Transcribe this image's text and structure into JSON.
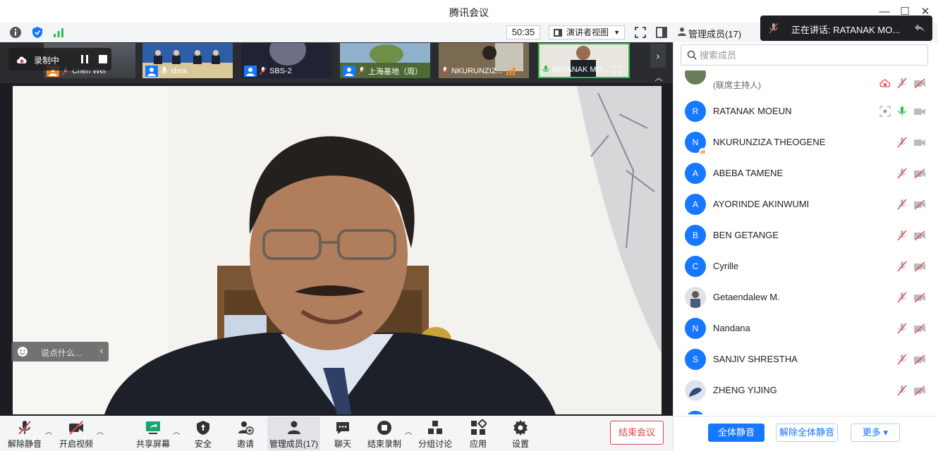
{
  "window": {
    "title": "腾讯会议",
    "minimize": "—",
    "maximize": "☐",
    "close": "✕"
  },
  "toolbar": {
    "timer": "50:35",
    "view_mode": "演讲者视图"
  },
  "recording": {
    "status": "录制中"
  },
  "thumbnails": [
    {
      "name": "Chen Wei"
    },
    {
      "name": "sbns"
    },
    {
      "name": "SBS-2"
    },
    {
      "name": "上海基地（周）"
    },
    {
      "name": "NKURUNZIZ..."
    },
    {
      "name": "RATANAK MO..."
    }
  ],
  "chat": {
    "placeholder": "说点什么..."
  },
  "bottom_bar": {
    "unmute": "解除静音",
    "start_video": "开启视频",
    "share_screen": "共享屏幕",
    "security": "安全",
    "invite": "邀请",
    "members": "管理成员(17)",
    "chat": "聊天",
    "stop_record": "结束录制",
    "breakout": "分组讨论",
    "apps": "应用",
    "settings": "设置",
    "end_meeting": "结束会议"
  },
  "panel": {
    "title": "管理成员(17)",
    "search_placeholder": "搜索成员",
    "cohost_note": "(联席主持人)",
    "members": [
      {
        "initial": "R",
        "name": "RATANAK MOEUN",
        "color": "#1677ff"
      },
      {
        "initial": "N",
        "name": "NKURUNZIZA THEOGENE",
        "color": "#1677ff"
      },
      {
        "initial": "A",
        "name": "ABEBA TAMENE",
        "color": "#1677ff"
      },
      {
        "initial": "A",
        "name": "AYORINDE AKINWUMI",
        "color": "#1677ff"
      },
      {
        "initial": "B",
        "name": "BEN GETANGE",
        "color": "#1677ff"
      },
      {
        "initial": "C",
        "name": "Cyrille",
        "color": "#1677ff"
      },
      {
        "initial": "",
        "name": "Getaendalew M.",
        "color": "#8a8f99"
      },
      {
        "initial": "N",
        "name": "Nandana",
        "color": "#1677ff"
      },
      {
        "initial": "S",
        "name": "SANJIV SHRESTHA",
        "color": "#1677ff"
      },
      {
        "initial": "",
        "name": "ZHENG YIJING",
        "color": "#2d4a7a"
      }
    ],
    "mute_all": "全体静音",
    "unmute_all": "解除全体静音",
    "more": "更多 ▾"
  },
  "toast": {
    "speaking": "正在讲话: RATANAK MO..."
  },
  "colors": {
    "accent": "#1677ff",
    "danger": "#e0434a",
    "mic_active": "#2fbf4a"
  }
}
